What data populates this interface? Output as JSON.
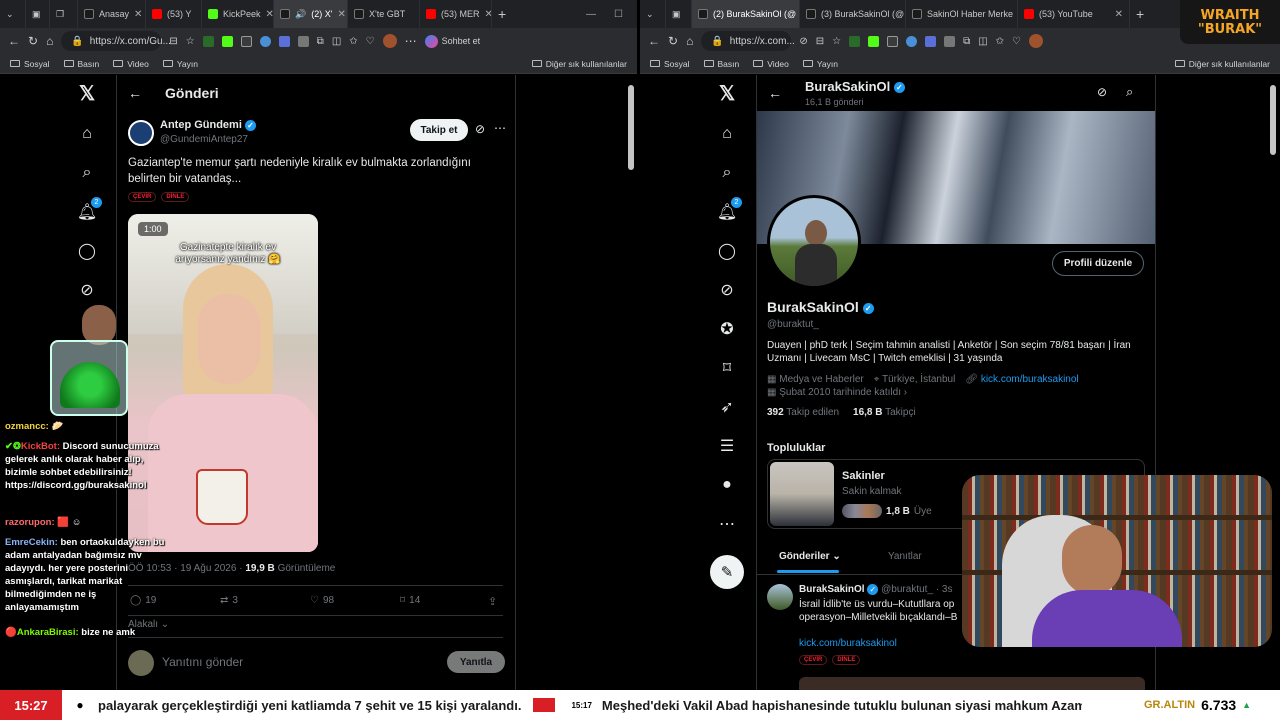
{
  "left_window": {
    "tabs": [
      {
        "label": "Anasay",
        "color": "#1a1a1a"
      },
      {
        "label": "(53) Y",
        "color": "#ff0000"
      },
      {
        "label": "KickPeek",
        "color": "#1a1a1a"
      },
      {
        "label": "(2) X'",
        "color": "#1a1a1a"
      },
      {
        "label": "X'te GBT",
        "color": "#1a1a1a"
      },
      {
        "label": "(53) MER",
        "color": "#ff0000"
      }
    ],
    "url": "https://x.com/Gu...",
    "copilot_label": "Sohbet et",
    "bookmarks": [
      "Sosyal",
      "Basın",
      "Video",
      "Yayın"
    ],
    "bookmarks_other": "Diğer sık kullanılanlar",
    "header_title": "Gönderi",
    "author_name": "Antep Gündemi",
    "author_handle": "@GundemiAntep27",
    "follow_label": "Takip et",
    "tweet_text": "Gaziantep'te memur şartı nedeniyle kiralık ev bulmakta zorlandığını belirten bir vatandaş...",
    "tag_translate": "ÇEVİR",
    "tag_listen": "DİNLE",
    "video_timer": "1:00",
    "video_caption": "Gazinatepte kiralık ev arıyorsanız yandınız 🤗",
    "timestamp": "ÖÖ 10:53 · 19 Ağu 2026 ·",
    "views_count": "19,9 B",
    "views_label": "Görüntüleme",
    "stats": {
      "replies": "19",
      "retweets": "3",
      "likes": "98",
      "bookmarks": "14"
    },
    "related_label": "Alakalı",
    "reply_placeholder": "Yanıtını gönder",
    "reply_button": "Yanıtla",
    "notif_count": "2"
  },
  "right_window": {
    "tabs": [
      {
        "label": "(2) BurakSakinOl (@",
        "color": "#1a1a1a"
      },
      {
        "label": "(3) BurakSakinOl (@",
        "color": "#1a1a1a"
      },
      {
        "label": "SakinOl Haber Merke",
        "color": "#1a1a1a"
      },
      {
        "label": "(53) YouTube",
        "color": "#ff0000"
      }
    ],
    "url": "https://x.com...",
    "bookmarks": [
      "Sosyal",
      "Basın",
      "Video",
      "Yayın"
    ],
    "bookmarks_other": "Diğer sık kullanılanlar",
    "header_name": "BurakSakinOl",
    "header_posts": "16,1 B gönderi",
    "edit_profile": "Profili düzenle",
    "profile_name": "BurakSakinOl",
    "profile_handle": "@buraktut_",
    "bio": "Duayen | phD terk | Seçim tahmin analisti | Anketör | Son seçim 78/81 başarı | İran Uzmanı | Livecam MsC | Twitch emeklisi | 31 yaşında",
    "category": "Medya ve Haberler",
    "location": "Türkiye, İstanbul",
    "website": "kick.com/buraksakinol",
    "joined": "Şubat 2010 tarihinde katıldı",
    "following_count": "392",
    "following_label": "Takip edilen",
    "followers_count": "16,8 B",
    "followers_label": "Takipçi",
    "communities_title": "Topluluklar",
    "community_name": "Sakinler",
    "community_sub": "Sakin kalmak",
    "community_members": "1,8 B",
    "community_members_label": "Üye",
    "tab_posts": "Gönderiler",
    "tab_replies": "Yanıtlar",
    "post_author": "BurakSakinOl",
    "post_handle": "@buraktut_ · 3s",
    "post_text": "İsrail İdlib'te üs vurdu–Kututllara op operasyon–Milletvekili bıçaklandı–B",
    "post_link": "kick.com/buraksakinol",
    "tag_translate": "ÇEVİR",
    "tag_listen": "DİNLE",
    "notif_count": "2"
  },
  "overlay": {
    "logo_line1": "WRAITH",
    "logo_line2": "\"BURAK\"",
    "chat": [
      {
        "user": "ozmancc:",
        "user_color": "#f5d442",
        "text": "🥟"
      },
      {
        "user": "KickBot:",
        "user_color": "#f54242",
        "text": "Discord sunucumuza gelerek anlık olarak haber alıp, bizimle sohbet edebilirsiniz! https://discord.gg/buraksakinol",
        "prefix": "✔❂"
      },
      {
        "user": "razorupon:",
        "user_color": "#ff6b6b",
        "text": "🟥 ☺"
      },
      {
        "user": "EmreCekin:",
        "user_color": "#8ab4f8",
        "text": "ben ortaokuldayken bu adam antalyadan bağımsız mv adayıydı. her yere posterini asmışlardı, tarikat marikat bilmediğimden ne iş anlayamamıştım"
      },
      {
        "user": "AnkaraBirasi:",
        "user_color": "#7CFC00",
        "text": "bize ne amk",
        "prefix": "🔴"
      }
    ],
    "ticker_time": "15:27",
    "ticker_text1": "palayarak gerçekleştirdiği yeni katliamda 7 şehit ve 15 kişi yaralandı.",
    "ticker_time2": "15:17",
    "ticker_text2": "Meşhed'deki Vakil Abad hapishanesinde tutuklu bulunan siyasi mahkum Azam",
    "ticker_gold_label": "GR.ALTIN",
    "ticker_gold_value": "6.733",
    "ticker_gold_arrow": "▲"
  },
  "colors": {
    "x_blue": "#1d9bf0",
    "ticker_red": "#d81f26",
    "bg": "#000000"
  }
}
